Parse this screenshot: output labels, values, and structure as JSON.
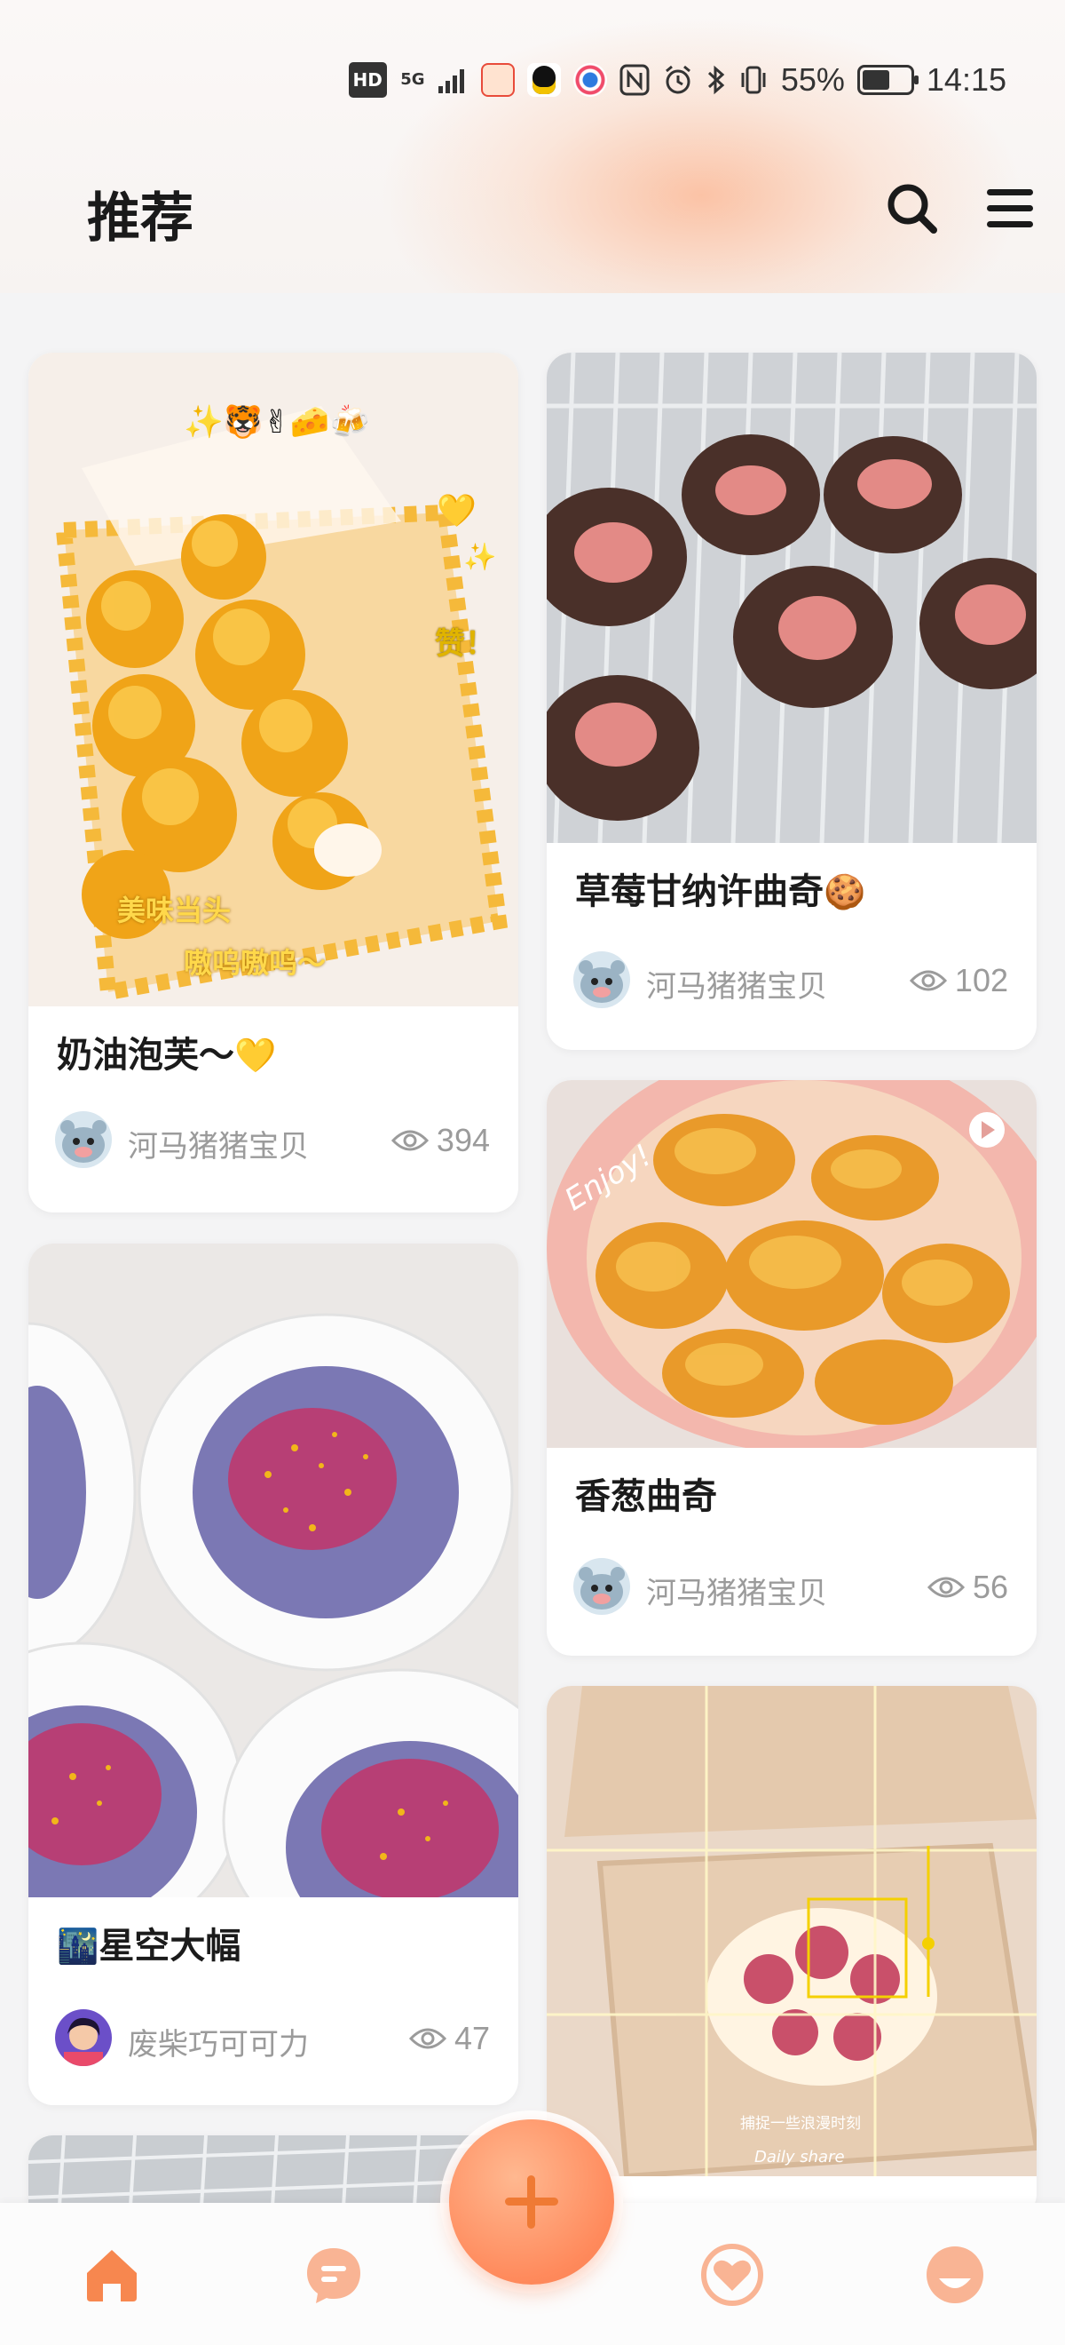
{
  "status_bar": {
    "hd": "HD",
    "network": "5G",
    "battery": "55%",
    "time": "14:15"
  },
  "header": {
    "title": "推荐"
  },
  "posts": [
    {
      "title": "奶油泡芙～",
      "title_emoji": "💛",
      "author": "河马猪猪宝贝",
      "views": "394"
    },
    {
      "title": "草莓甘纳许曲奇",
      "title_emoji": "🍪",
      "author": "河马猪猪宝贝",
      "views": "102"
    },
    {
      "title": "香葱曲奇",
      "title_emoji": "",
      "author": "河马猪猪宝贝",
      "views": "56"
    },
    {
      "title": "星空大幅",
      "title_emoji": "🌃",
      "author": "废柴巧可可力",
      "views": "47"
    }
  ],
  "image_texts": {
    "puff_caption_1": "美味当头",
    "puff_caption_2": "嗷呜嗷呜～",
    "puff_zan": "赞！",
    "cake_caption": "捕捉一些浪漫时刻",
    "cake_daily": "Daily share",
    "cookie_enjoy": "Enjoy!"
  },
  "nav": {
    "items": [
      "home",
      "chat",
      "favorites",
      "profile"
    ],
    "active": "home",
    "accent": "#f7874f"
  }
}
